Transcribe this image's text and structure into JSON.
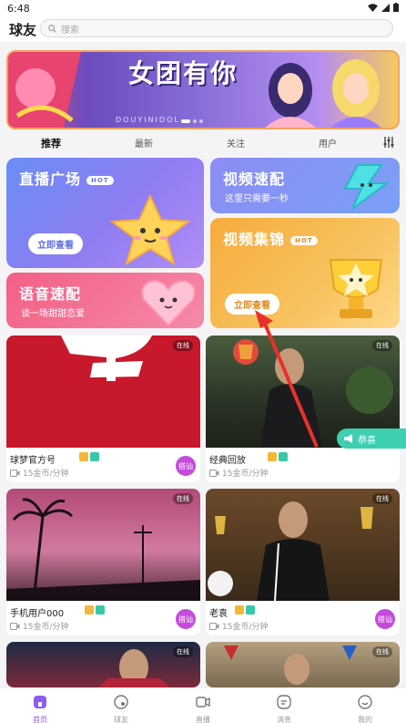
{
  "status_bar": {
    "time": "6:48"
  },
  "header": {
    "app_title": "球友",
    "search_placeholder": "搜索"
  },
  "banner": {
    "title": "女团有你",
    "subtitle": "DOUYINIDOL"
  },
  "tabs": [
    {
      "label": "推荐",
      "active": true
    },
    {
      "label": "最新",
      "active": false
    },
    {
      "label": "关注",
      "active": false
    },
    {
      "label": "用户",
      "active": false
    }
  ],
  "features": {
    "live": {
      "title": "直播广场",
      "hot": "HOT",
      "button": "立即查看"
    },
    "video_match": {
      "title": "视频速配",
      "subtitle": "这里只需要一秒"
    },
    "voice_match": {
      "title": "语音速配",
      "subtitle": "谈一场甜甜恋爱"
    },
    "video_best": {
      "title": "视频集锦",
      "hot": "HOT",
      "button": "立即查看"
    }
  },
  "cards": [
    {
      "name": "球梦官方号",
      "price": "15金币/分钟",
      "status": "在线",
      "chat": "搭讪"
    },
    {
      "name": "经典回放",
      "price": "15金币/分钟",
      "status": "在线",
      "chat": "搭讪"
    },
    {
      "name": "手机用户000",
      "price": "15金币/分钟",
      "status": "在线",
      "chat": "搭讪"
    },
    {
      "name": "老袁",
      "price": "15金币/分钟",
      "status": "在线",
      "chat": "搭讪"
    },
    {
      "status": "在线"
    },
    {
      "status": "在线"
    }
  ],
  "gift_tag": {
    "label": "恭喜"
  },
  "bottom_nav": [
    {
      "label": "首页",
      "active": true
    },
    {
      "label": "球友",
      "active": false
    },
    {
      "label": "直播",
      "active": false
    },
    {
      "label": "消息",
      "active": false
    },
    {
      "label": "我的",
      "active": false
    }
  ],
  "colors": {
    "accent": "#8a5cf0",
    "hot_orange": "#f7ab3e",
    "online_green": "#3ecfb0"
  }
}
